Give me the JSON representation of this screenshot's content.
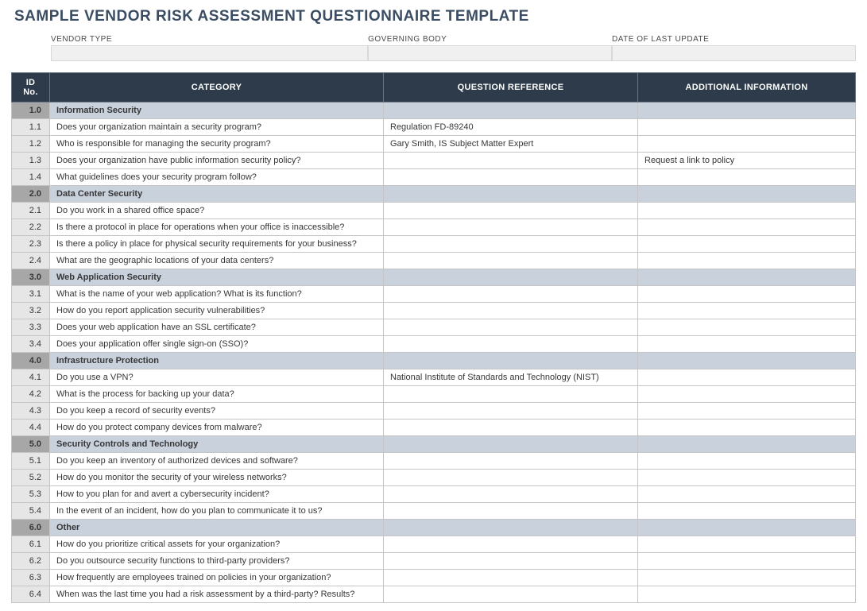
{
  "title": "SAMPLE VENDOR RISK ASSESSMENT QUESTIONNAIRE TEMPLATE",
  "meta": {
    "vendor_type_label": "VENDOR TYPE",
    "vendor_type_value": "",
    "governing_body_label": "GOVERNING BODY",
    "governing_body_value": "",
    "date_label": "DATE OF LAST UPDATE",
    "date_value": ""
  },
  "columns": {
    "id": "ID No.",
    "category": "CATEGORY",
    "reference": "QUESTION REFERENCE",
    "info": "ADDITIONAL INFORMATION"
  },
  "rows": [
    {
      "type": "section",
      "id": "1.0",
      "category": "Information Security",
      "reference": "",
      "info": ""
    },
    {
      "type": "q",
      "id": "1.1",
      "category": "Does your organization maintain a security program?",
      "reference": "Regulation FD-89240",
      "info": ""
    },
    {
      "type": "q",
      "id": "1.2",
      "category": "Who is responsible for managing the security program?",
      "reference": "Gary Smith, IS Subject Matter Expert",
      "info": ""
    },
    {
      "type": "q",
      "id": "1.3",
      "category": "Does your organization have public information security policy?",
      "reference": "",
      "info": "Request a link to policy"
    },
    {
      "type": "q",
      "id": "1.4",
      "category": "What guidelines does your security program follow?",
      "reference": "",
      "info": ""
    },
    {
      "type": "section",
      "id": "2.0",
      "category": "Data Center Security",
      "reference": "",
      "info": ""
    },
    {
      "type": "q",
      "id": "2.1",
      "category": "Do you work in a shared office space?",
      "reference": "",
      "info": ""
    },
    {
      "type": "q",
      "id": "2.2",
      "category": "Is there a protocol in place for operations when your office is inaccessible?",
      "reference": "",
      "info": ""
    },
    {
      "type": "q",
      "id": "2.3",
      "category": "Is there a policy in place for physical security requirements for your business?",
      "reference": "",
      "info": ""
    },
    {
      "type": "q",
      "id": "2.4",
      "category": "What are the geographic locations of your data centers?",
      "reference": "",
      "info": ""
    },
    {
      "type": "section",
      "id": "3.0",
      "category": "Web Application Security",
      "reference": "",
      "info": ""
    },
    {
      "type": "q",
      "id": "3.1",
      "category": "What is the name of your web application? What is its function?",
      "reference": "",
      "info": ""
    },
    {
      "type": "q",
      "id": "3.2",
      "category": "How do you report application security vulnerabilities?",
      "reference": "",
      "info": ""
    },
    {
      "type": "q",
      "id": "3.3",
      "category": "Does your web application have an SSL certificate?",
      "reference": "",
      "info": ""
    },
    {
      "type": "q",
      "id": "3.4",
      "category": "Does your application offer single sign-on (SSO)?",
      "reference": "",
      "info": ""
    },
    {
      "type": "section",
      "id": "4.0",
      "category": "Infrastructure Protection",
      "reference": "",
      "info": ""
    },
    {
      "type": "q",
      "id": "4.1",
      "category": "Do you use a VPN?",
      "reference": "National Institute of Standards and Technology (NIST)",
      "info": ""
    },
    {
      "type": "q",
      "id": "4.2",
      "category": "What is the process for backing up your data?",
      "reference": "",
      "info": ""
    },
    {
      "type": "q",
      "id": "4.3",
      "category": "Do you keep a record of security events?",
      "reference": "",
      "info": ""
    },
    {
      "type": "q",
      "id": "4.4",
      "category": "How do you protect company devices from malware?",
      "reference": "",
      "info": ""
    },
    {
      "type": "section",
      "id": "5.0",
      "category": "Security Controls and Technology",
      "reference": "",
      "info": ""
    },
    {
      "type": "q",
      "id": "5.1",
      "category": "Do you keep an inventory of authorized devices and software?",
      "reference": "",
      "info": ""
    },
    {
      "type": "q",
      "id": "5.2",
      "category": "How do you monitor the security of your wireless networks?",
      "reference": "",
      "info": ""
    },
    {
      "type": "q",
      "id": "5.3",
      "category": "How to you plan for and avert a cybersecurity incident?",
      "reference": "",
      "info": ""
    },
    {
      "type": "q",
      "id": "5.4",
      "category": "In the event of an incident, how do you plan to communicate it to us?",
      "reference": "",
      "info": ""
    },
    {
      "type": "section",
      "id": "6.0",
      "category": "Other",
      "reference": "",
      "info": ""
    },
    {
      "type": "q",
      "id": "6.1",
      "category": "How do you prioritize critical assets for your organization?",
      "reference": "",
      "info": ""
    },
    {
      "type": "q",
      "id": "6.2",
      "category": "Do you outsource security functions to third-party providers?",
      "reference": "",
      "info": ""
    },
    {
      "type": "q",
      "id": "6.3",
      "category": "How frequently are employees trained on policies in your organization?",
      "reference": "",
      "info": ""
    },
    {
      "type": "q",
      "id": "6.4",
      "category": "When was the last time you had a risk assessment by a third-party? Results?",
      "reference": "",
      "info": ""
    }
  ]
}
